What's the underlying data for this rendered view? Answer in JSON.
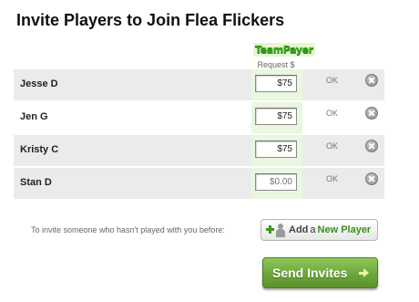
{
  "page": {
    "title": "Invite Players to Join Flea Flickers"
  },
  "teampayer": {
    "logo_text": "TeamPayer",
    "column_label": "Request $"
  },
  "players": [
    {
      "name": "Jesse D",
      "amount": "$75",
      "status": "OK"
    },
    {
      "name": "Jen G",
      "amount": "$75",
      "status": "OK"
    },
    {
      "name": "Kristy C",
      "amount": "$75",
      "status": "OK"
    },
    {
      "name": "Stan D",
      "amount_placeholder": "$0.00",
      "status": "OK"
    }
  ],
  "invite": {
    "prompt": "To invite someone who hasn't played with you before:",
    "add_button": {
      "part1": "Add",
      "part2": "a",
      "part3": "New Player"
    }
  },
  "actions": {
    "send_label": "Send Invites"
  },
  "colors": {
    "accent_green": "#6fa93b",
    "row_shade": "#ebebeb",
    "request_column": "#e9f6e0"
  },
  "icons": {
    "remove": "remove-circle-x-icon",
    "add": "plus-icon",
    "person": "person-icon",
    "send": "arrow-right-icon"
  }
}
